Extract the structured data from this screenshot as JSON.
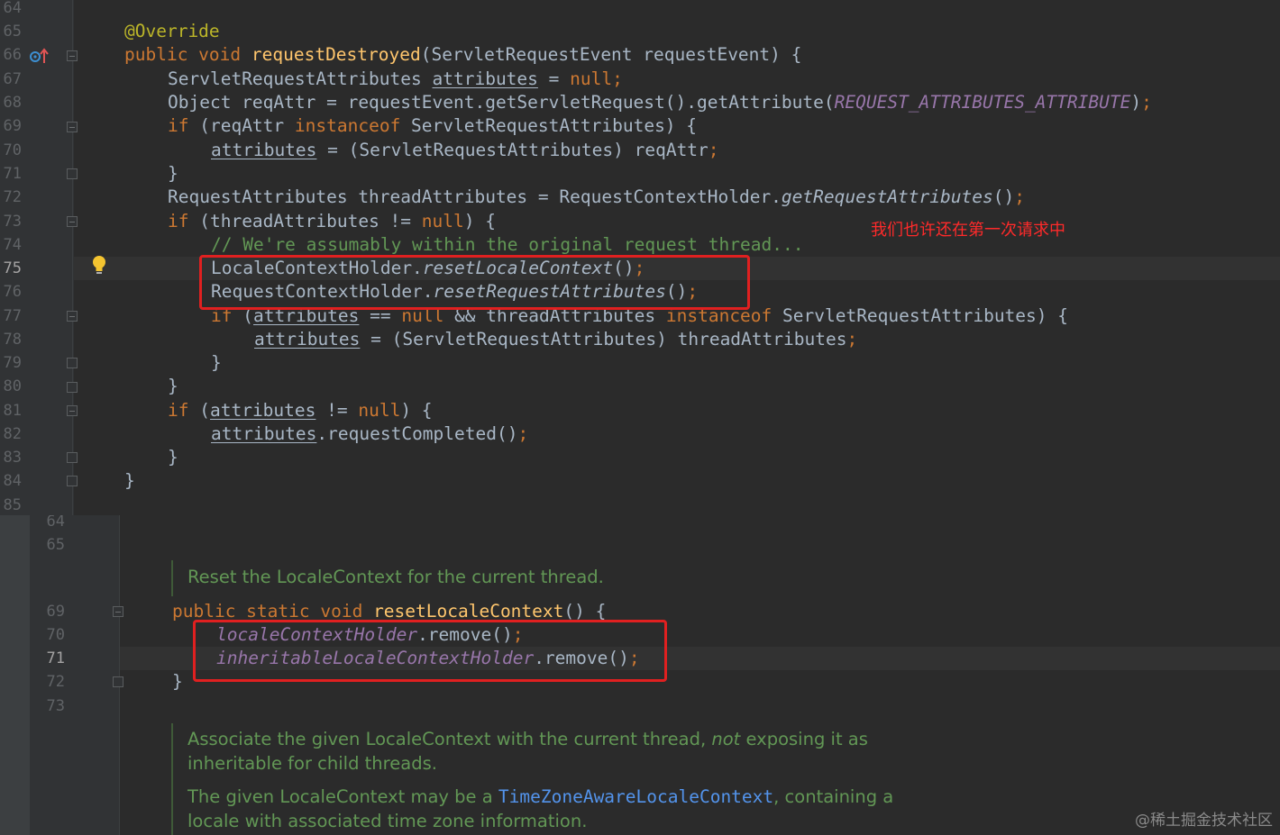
{
  "editor_top": {
    "line_numbers": [
      "64",
      "65",
      "66",
      "67",
      "68",
      "69",
      "70",
      "71",
      "72",
      "73",
      "74",
      "75",
      "76",
      "77",
      "78",
      "79",
      "80",
      "81",
      "82",
      "83",
      "84",
      "85"
    ],
    "active_line": "75",
    "annotation": "@Override",
    "comment": "// We're assumably within the original request thread...",
    "red_note": "我们也许还在第一次请求中"
  },
  "editor_bottom": {
    "line_numbers": [
      "64",
      "65",
      "69",
      "70",
      "71",
      "72",
      "73"
    ],
    "active_line": "71",
    "doc1": "Reset the LocaleContext for the current thread.",
    "doc2_prefix": "Associate the given LocaleContext with the current thread,",
    "doc2_em": "not",
    "doc2_suffix": "exposing it as",
    "doc2_line2": "inheritable for child threads.",
    "doc3_prefix": "The given LocaleContext may be a",
    "doc3_code": "TimeZoneAwareLocaleContext",
    "doc3_suffix": ", containing a",
    "doc3_line2": "locale with associated time zone information."
  },
  "watermark": "@稀土掘金技术社区",
  "icons": [
    "override-method-icon",
    "intention-bulb-icon",
    "fold-marker-icon"
  ],
  "colors": {
    "background": "#2b2b2b",
    "keyword": "#cc7832",
    "function": "#ffc66d",
    "comment": "#629755",
    "highlight_box": "#e02020"
  }
}
